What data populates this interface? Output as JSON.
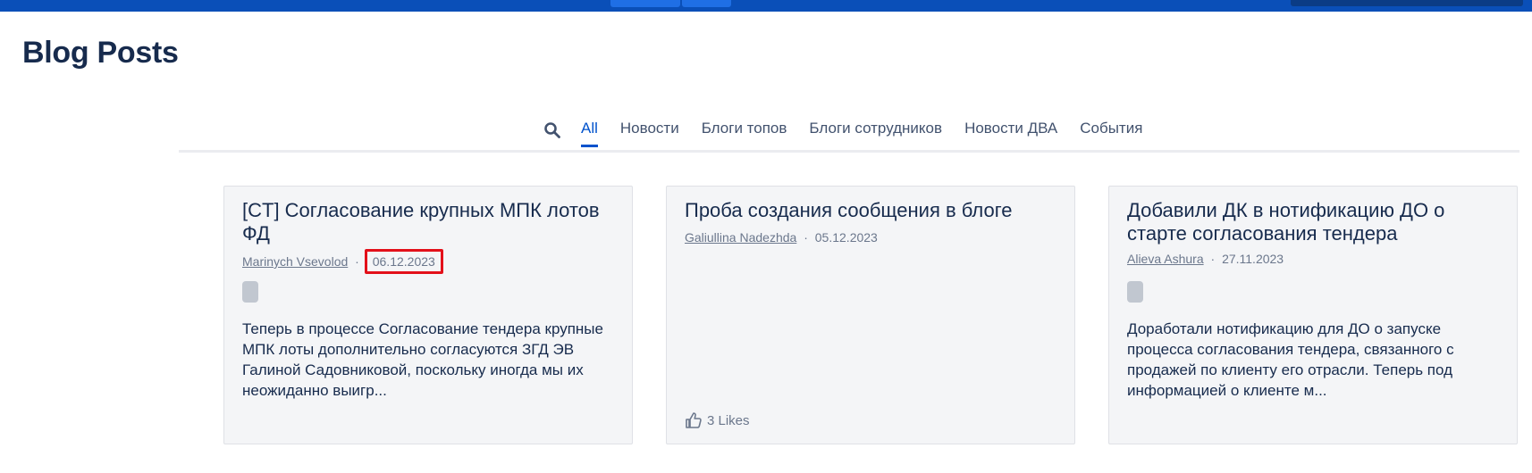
{
  "page": {
    "title": "Blog Posts"
  },
  "tabs": [
    "All",
    "Новости",
    "Блоги топов",
    "Блоги сотрудников",
    "Новости ДВА",
    "События"
  ],
  "active_tab": "All",
  "colors": {
    "accent": "#0052cc",
    "topbar": "#0a4fb8",
    "highlight": "#e3101a"
  },
  "posts": [
    {
      "title": "[CT] Согласование крупных МПК лотов ФД",
      "author": "Marinych Vsevolod",
      "separator": "·",
      "date": "06.12.2023",
      "excerpt": "Теперь в процессе Согласование тендера крупные МПК лоты дополнительно согласуются ЗГД ЭВ Галиной Садовниковой, поскольку иногда мы их неожиданно выигр...",
      "date_highlighted": true
    },
    {
      "title": "Проба создания сообщения в блоге",
      "author": "Galiullina Nadezhda",
      "separator": "·",
      "date": "05.12.2023",
      "likes": "3 Likes",
      "like_icon": "thumbs-up-icon"
    },
    {
      "title": "Добавили ДК в нотификацию ДО о старте согласования тендера",
      "author": "Alieva Ashura",
      "separator": "·",
      "date": "27.11.2023",
      "excerpt": "Доработали нотификацию для ДО о запуске процесса согласования тендера, связанного с продажей по клиенту его отрасли. Теперь под информацией о клиенте м..."
    }
  ],
  "icons": {
    "search": "search-icon"
  }
}
